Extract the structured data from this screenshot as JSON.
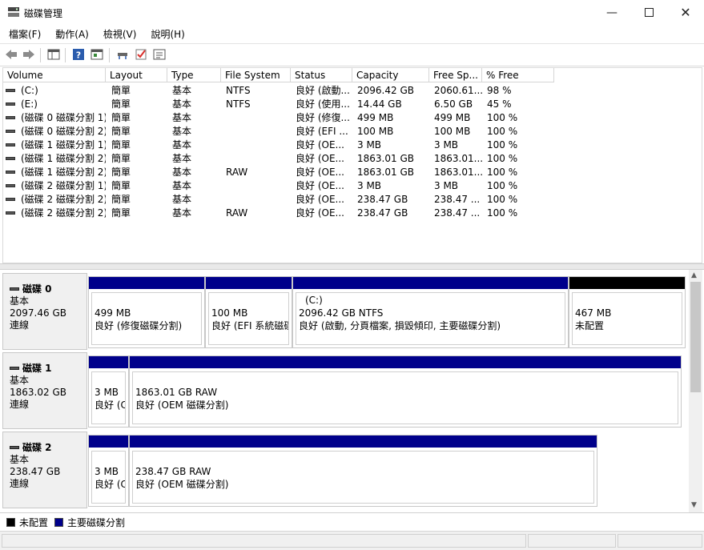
{
  "window": {
    "title": "磁碟管理"
  },
  "menu": [
    "檔案(F)",
    "動作(A)",
    "檢視(V)",
    "說明(H)"
  ],
  "columns": [
    "Volume",
    "Layout",
    "Type",
    "File System",
    "Status",
    "Capacity",
    "Free Sp...",
    "% Free"
  ],
  "volumes": [
    [
      "(C:)",
      "簡單",
      "基本",
      "NTFS",
      "良好 (啟動...",
      "2096.42 GB",
      "2060.61...",
      "98 %"
    ],
    [
      "(E:)",
      "簡單",
      "基本",
      "NTFS",
      "良好 (使用...",
      "14.44 GB",
      "6.50 GB",
      "45 %"
    ],
    [
      "(磁碟 0 磁碟分割 1)",
      "簡單",
      "基本",
      "",
      "良好 (修復...",
      "499 MB",
      "499 MB",
      "100 %"
    ],
    [
      "(磁碟 0 磁碟分割 2)",
      "簡單",
      "基本",
      "",
      "良好 (EFI ...",
      "100 MB",
      "100 MB",
      "100 %"
    ],
    [
      "(磁碟 1 磁碟分割 1)",
      "簡單",
      "基本",
      "",
      "良好 (OE...",
      "3 MB",
      "3 MB",
      "100 %"
    ],
    [
      "(磁碟 1 磁碟分割 2)",
      "簡單",
      "基本",
      "",
      "良好 (OE...",
      "1863.01 GB",
      "1863.01...",
      "100 %"
    ],
    [
      "(磁碟 1 磁碟分割 2)",
      "簡單",
      "基本",
      "RAW",
      "良好 (OE...",
      "1863.01 GB",
      "1863.01...",
      "100 %"
    ],
    [
      "(磁碟 2 磁碟分割 1)",
      "簡單",
      "基本",
      "",
      "良好 (OE...",
      "3 MB",
      "3 MB",
      "100 %"
    ],
    [
      "(磁碟 2 磁碟分割 2)",
      "簡單",
      "基本",
      "",
      "良好 (OE...",
      "238.47 GB",
      "238.47 ...",
      "100 %"
    ],
    [
      "(磁碟 2 磁碟分割 2)",
      "簡單",
      "基本",
      "RAW",
      "良好 (OE...",
      "238.47 GB",
      "238.47 ...",
      "100 %"
    ]
  ],
  "disks": [
    {
      "name": "磁碟 0",
      "type": "基本",
      "size": "2097.46 GB",
      "state": "連線",
      "partitions": [
        {
          "label": "",
          "size": "499 MB",
          "status": "良好 (修復磁碟分割)"
        },
        {
          "label": "",
          "size": "100 MB",
          "status": "良好 (EFI 系統磁碟"
        },
        {
          "label": "(C:)",
          "size": "2096.42 GB NTFS",
          "status": "良好 (啟動, 分頁檔案, 損毀傾印, 主要磁碟分割)"
        },
        {
          "label": "",
          "size": "467 MB",
          "status": "未配置"
        }
      ]
    },
    {
      "name": "磁碟 1",
      "type": "基本",
      "size": "1863.02 GB",
      "state": "連線",
      "partitions": [
        {
          "label": "",
          "size": "3 MB",
          "status": "良好 (C"
        },
        {
          "label": "",
          "size": "1863.01 GB RAW",
          "status": "良好 (OEM 磁碟分割)"
        }
      ]
    },
    {
      "name": "磁碟 2",
      "type": "基本",
      "size": "238.47 GB",
      "state": "連線",
      "partitions": [
        {
          "label": "",
          "size": "3 MB",
          "status": "良好 (C"
        },
        {
          "label": "",
          "size": "238.47 GB RAW",
          "status": "良好 (OEM 磁碟分割)"
        }
      ]
    }
  ],
  "legend": [
    "未配置",
    "主要磁碟分割"
  ],
  "colors": {
    "primary_partition": "#00008b",
    "unallocated": "#000000"
  }
}
